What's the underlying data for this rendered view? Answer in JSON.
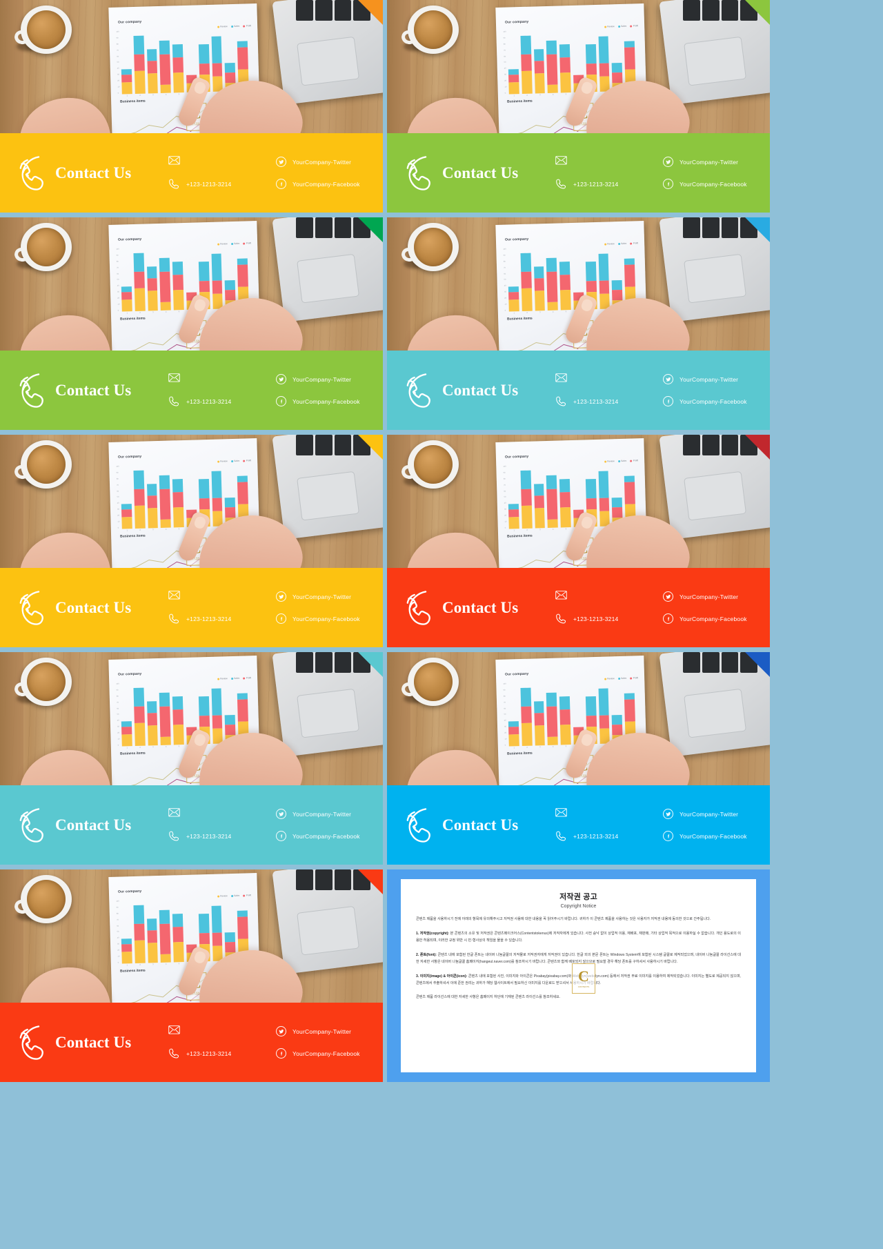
{
  "page": {
    "background_color": "#8fc0d8",
    "grid": {
      "columns": 2,
      "rows": 5
    }
  },
  "contact": {
    "title": "Contact Us",
    "email_value": "",
    "phone": "+123-1213-3214",
    "twitter": "YourCompany-Twitter",
    "facebook": "YourCompany-Facebook",
    "icons": {
      "brand": "phone-ring-icon",
      "email": "envelope-icon",
      "phone": "phone-handset-icon",
      "twitter": "twitter-bird-icon",
      "facebook": "facebook-f-icon"
    }
  },
  "photo": {
    "chart_title": "Our company",
    "chart_sub": "Business items",
    "logo_letter": "C",
    "logo_name": "CONTENTS",
    "logo_tag": "PPT / TEMPLATE"
  },
  "chart_data": {
    "type": "bar",
    "stacked": true,
    "title": "Our company",
    "subtitle": "Business items",
    "xlabel": "",
    "ylabel": "",
    "ylim": [
      0,
      100
    ],
    "grid": false,
    "legend_position": "top-right",
    "categories": [
      "1",
      "2",
      "3",
      "4",
      "5",
      "6",
      "7",
      "8",
      "9",
      "10"
    ],
    "tick_labels_y": [
      "100",
      "90",
      "80",
      "70",
      "60",
      "50",
      "40",
      "30",
      "20",
      "10",
      "0"
    ],
    "series": [
      {
        "name": "Yellow",
        "color": "#fbc341",
        "values": [
          18,
          36,
          31,
          13,
          32,
          14,
          27,
          24,
          13,
          34
        ]
      },
      {
        "name": "Red",
        "color": "#f4676f",
        "values": [
          12,
          26,
          20,
          48,
          23,
          13,
          18,
          21,
          16,
          35
        ]
      },
      {
        "name": "Cyan",
        "color": "#4cc3dd",
        "values": [
          9,
          29,
          19,
          22,
          21,
          0,
          30,
          42,
          16,
          9
        ]
      }
    ],
    "legend": [
      {
        "label": "Review",
        "color": "#fbc341"
      },
      {
        "label": "Sales",
        "color": "#4cc3dd"
      },
      {
        "label": "Profit",
        "color": "#f4676f"
      }
    ]
  },
  "slides": [
    {
      "id": 1,
      "accent": "#fcc211",
      "corner": "#f6921e",
      "type": "contact"
    },
    {
      "id": 2,
      "accent": "#8cc63e",
      "corner": "#8cc63e",
      "type": "contact"
    },
    {
      "id": 3,
      "accent": "#8cc63e",
      "corner": "#00a651",
      "type": "contact"
    },
    {
      "id": 4,
      "accent": "#5ac8d0",
      "corner": "#29abe2",
      "type": "contact"
    },
    {
      "id": 5,
      "accent": "#fcc211",
      "corner": "#fcc211",
      "type": "contact"
    },
    {
      "id": 6,
      "accent": "#fa3a14",
      "corner": "#c1272d",
      "type": "contact"
    },
    {
      "id": 7,
      "accent": "#5ac8d0",
      "corner": "#5ac8d0",
      "type": "contact"
    },
    {
      "id": 8,
      "accent": "#00b2ef",
      "corner": "#1b5cc4",
      "type": "contact"
    },
    {
      "id": 9,
      "accent": "#fa3a14",
      "corner": "#fa3a14",
      "type": "contact"
    },
    {
      "id": 10,
      "accent": "#4ea0ee",
      "corner": "#4ea0ee",
      "type": "copyright"
    }
  ],
  "copyright": {
    "heading": "저작권 공고",
    "subheading": "Copyright Notice",
    "intro": "콘텐츠 제품을 사용하시기 전에 아래의 항목에 유의해주시고 저작권 사용에 대한 내용을 꼭 읽어주시기 바랍니다. 귀하가 이 콘텐츠 제품을 사용하는 것은 사용자가 저작권 내용에 동의한 것으로 간주됩니다.",
    "items": [
      {
        "label": "1. 저작권(copyright):",
        "text": "본 콘텐츠의 소유 및 저작권은 콘텐츠메이크어스(Contentstokenus)에 저작자에게 있습니다. 사전 승낙 없이 상업적 이용, 재배포, 재판매, 기타 상업적 목적으로 이용하실 수 없습니다. 개인 용도로의 이용만 허용되며, 이러한 규정 위반 시 민·형사상의 책임을 물을 수 있습니다."
      },
      {
        "label": "2. 폰트(font):",
        "text": "콘텐츠 내에 포함된 한글 폰트는 네이버 나눔글꼴의 저작물로 저작권자에게 저작권이 있습니다. 한글 외의 본문 폰트는 Windows System에 포함된 시스템 글꼴로 제작되었으며, 네이버 나눔글꼴 라이선스에 대한 자세한 사항은 네이버 나눔글꼴 홈페이지(hangeul.naver.com)를 참조하시기 바랍니다. 콘텐츠와 함께 배포되지 않으므로 필요할 경우 해당 폰트를 구하셔서 사용하시기 바랍니다."
      },
      {
        "label": "3. 이미지(image) & 아이콘(icon):",
        "text": "콘텐츠 내에 포함된 사진, 이미지와 아이콘은 Pixabay(pixabay.com)와 Webelyn(webelyn.com) 등에서 저작권 무료 이미지를 이용하여 제작되었습니다. 이미지는 별도로 제공되지 않으며, 콘텐츠에서 추출하셔서 이에 준한 권리는 귀하가 해당 웹사이트에서 필요하신 이미지를 다운로드 받으셔서 사용하시기 바랍니다."
      }
    ],
    "footer": "콘텐츠 제품 라이선스에 대한 자세한 사항은 홈페이지 하단에 기재된 콘텐츠 라이선스를 참조하세요."
  }
}
